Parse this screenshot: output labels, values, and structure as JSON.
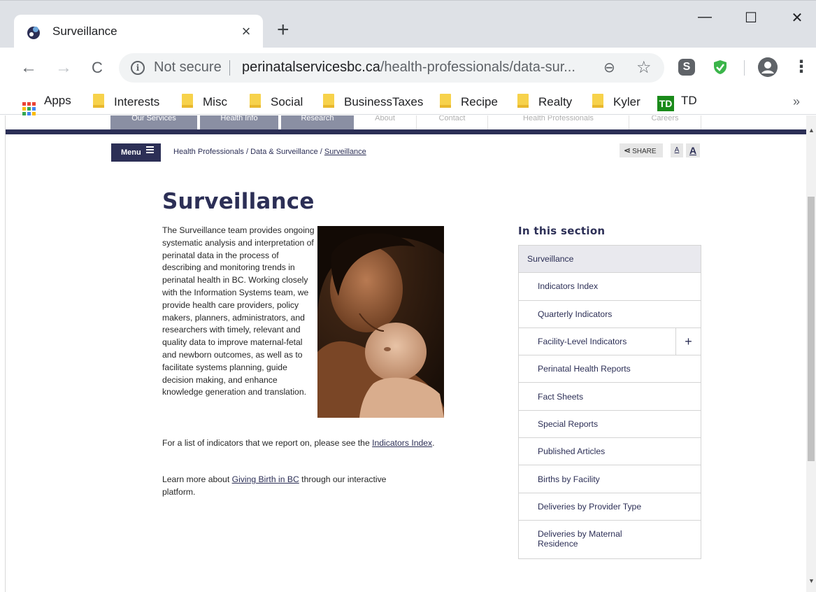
{
  "browser": {
    "tab_title": "Surveillance",
    "tab_close": "×",
    "new_tab": "+",
    "window_controls": {
      "minimize": "—",
      "maximize": "☐",
      "close": "✕"
    },
    "nav": {
      "back": "←",
      "forward": "→",
      "reload": "C"
    },
    "security_label": "Not secure",
    "url_domain": "perinatalservicesbc.ca",
    "url_path": "/health-professionals/data-sur...",
    "icons": [
      "info-icon",
      "zoom-icon",
      "star-icon",
      "skype-icon",
      "shield-icon",
      "profile-icon",
      "menu-kebab-icon"
    ]
  },
  "bookmarks": [
    {
      "label": "Apps",
      "icon": "apps-grid-icon"
    },
    {
      "label": "Interests",
      "icon": "folder-icon"
    },
    {
      "label": "Misc",
      "icon": "folder-icon"
    },
    {
      "label": "Social",
      "icon": "folder-icon"
    },
    {
      "label": "BusinessTaxes",
      "icon": "folder-icon"
    },
    {
      "label": "Recipe",
      "icon": "folder-icon"
    },
    {
      "label": "Realty",
      "icon": "folder-icon"
    },
    {
      "label": "Kyler",
      "icon": "folder-icon"
    },
    {
      "label": "TD",
      "icon": "td-logo-icon",
      "logo_text": "TD"
    }
  ],
  "bookmarks_more": "»",
  "site": {
    "top_nav": [
      "Our Services",
      "Health Info",
      "Research",
      "About",
      "Contact",
      "Health Professionals",
      "Careers"
    ],
    "menu_label": "Menu",
    "breadcrumb": {
      "items": [
        "Health Professionals",
        "Data & Surveillance",
        "Surveillance"
      ],
      "separator": "/"
    },
    "share_label": "SHARE",
    "text_small": "A",
    "text_large": "A",
    "colors": {
      "brand_navy": "#2c2f56",
      "nav_tab": "#8a8fa3",
      "section_active_bg": "#e9e9ee"
    }
  },
  "content": {
    "title": "Surveillance",
    "intro": "The Surveillance team provides ongoing systematic analysis and interpretation of perinatal data in the process of describing and monitoring trends in perinatal health in BC. Working closely with the Information Systems team, we provide health care providers, policy makers, planners, administrators, and researchers with timely, relevant and quality data to improve maternal-fetal and newborn outcomes, as well as to facilitate systems planning, guide decision making, and enhance knowledge generation and translation.",
    "para1_before": "For a list of indicators that we report on, please see the ",
    "para1_link": "Indicators Index",
    "para1_after": ".",
    "para2_before": "Learn more about ",
    "para2_link": "Giving Birth in BC",
    "para2_after": " through our interactive platform.",
    "photo": "mother-kissing-newborn-photo"
  },
  "sidebar": {
    "heading": "In this section",
    "items": [
      {
        "label": "Surveillance",
        "active": true
      },
      {
        "label": "Indicators Index"
      },
      {
        "label": "Quarterly Indicators"
      },
      {
        "label": "Facility-Level Indicators",
        "expand": "+"
      },
      {
        "label": "Perinatal Health Reports"
      },
      {
        "label": "Fact Sheets"
      },
      {
        "label": "Special Reports"
      },
      {
        "label": "Published Articles"
      },
      {
        "label": "Births by Facility"
      },
      {
        "label": "Deliveries by Provider Type"
      },
      {
        "label": "Deliveries by Maternal Residence"
      }
    ]
  }
}
